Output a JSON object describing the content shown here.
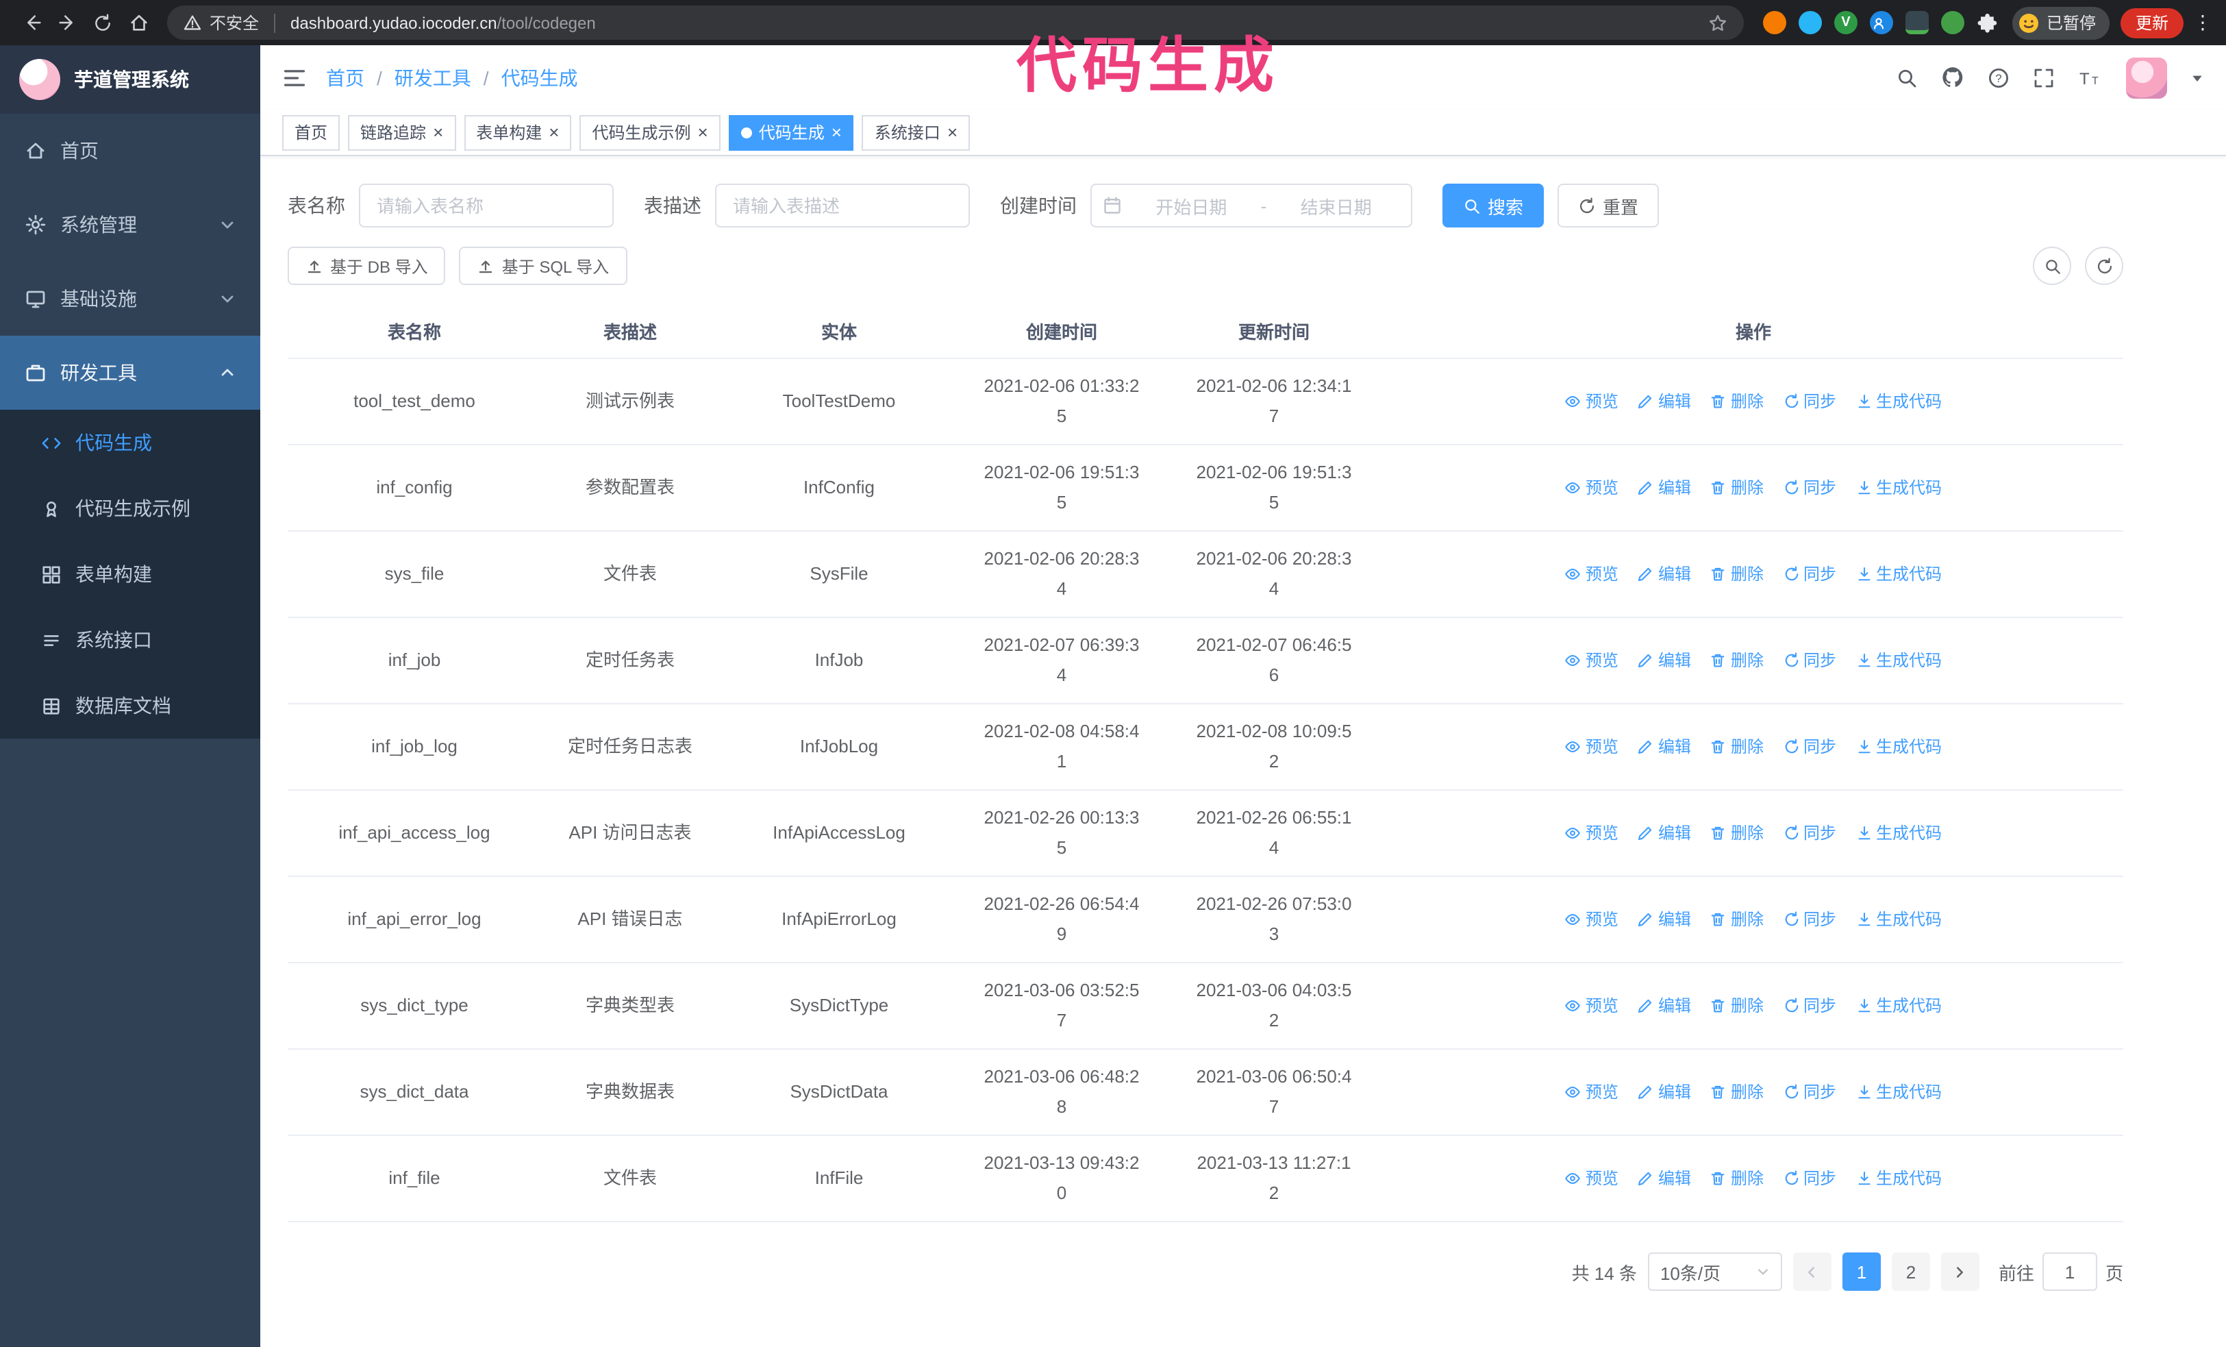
{
  "theme": {
    "accent": "#409eff",
    "sidebar_bg": "#304156",
    "submenu_bg": "#1f2d3d",
    "annotation_color": "#ee3f7d",
    "update_button_bg": "#d93025"
  },
  "annotation": {
    "text": "代码生成"
  },
  "browser": {
    "security_label": "不安全",
    "url_domain": "dashboard.yudao.iocoder.cn",
    "url_path": "/tool/codegen",
    "profile_badge": "已暂停",
    "update_label": "更新",
    "kebab": "⋮",
    "extension_v_label": "V"
  },
  "sidebar": {
    "title": "芋道管理系统",
    "items": [
      {
        "label": "首页"
      },
      {
        "label": "系统管理"
      },
      {
        "label": "基础设施"
      },
      {
        "label": "研发工具"
      }
    ],
    "subitems": [
      {
        "label": "代码生成"
      },
      {
        "label": "代码生成示例"
      },
      {
        "label": "表单构建"
      },
      {
        "label": "系统接口"
      },
      {
        "label": "数据库文档"
      }
    ]
  },
  "breadcrumb": {
    "items": [
      "首页",
      "研发工具",
      "代码生成"
    ],
    "separator": "/"
  },
  "tabs": [
    {
      "label": "首页"
    },
    {
      "label": "链路追踪"
    },
    {
      "label": "表单构建"
    },
    {
      "label": "代码生成示例"
    },
    {
      "label": "代码生成"
    },
    {
      "label": "系统接口"
    }
  ],
  "tab_close": "×",
  "filters": {
    "table_name_label": "表名称",
    "table_name_placeholder": "请输入表名称",
    "table_desc_label": "表描述",
    "table_desc_placeholder": "请输入表描述",
    "create_time_label": "创建时间",
    "date_start": "开始日期",
    "date_sep": "-",
    "date_end": "结束日期",
    "search": "搜索",
    "reset": "重置"
  },
  "toolbar": {
    "import_db": "基于 DB 导入",
    "import_sql": "基于 SQL 导入"
  },
  "table": {
    "columns": [
      "表名称",
      "表描述",
      "实体",
      "创建时间",
      "更新时间",
      "操作"
    ],
    "actions": [
      "预览",
      "编辑",
      "删除",
      "同步",
      "生成代码"
    ],
    "rows": [
      {
        "name": "tool_test_demo",
        "desc": "测试示例表",
        "entity": "ToolTestDemo",
        "created": "2021-02-06 01:33:25",
        "updated": "2021-02-06 12:34:17"
      },
      {
        "name": "inf_config",
        "desc": "参数配置表",
        "entity": "InfConfig",
        "created": "2021-02-06 19:51:35",
        "updated": "2021-02-06 19:51:35"
      },
      {
        "name": "sys_file",
        "desc": "文件表",
        "entity": "SysFile",
        "created": "2021-02-06 20:28:34",
        "updated": "2021-02-06 20:28:34"
      },
      {
        "name": "inf_job",
        "desc": "定时任务表",
        "entity": "InfJob",
        "created": "2021-02-07 06:39:34",
        "updated": "2021-02-07 06:46:56"
      },
      {
        "name": "inf_job_log",
        "desc": "定时任务日志表",
        "entity": "InfJobLog",
        "created": "2021-02-08 04:58:41",
        "updated": "2021-02-08 10:09:52"
      },
      {
        "name": "inf_api_access_log",
        "desc": "API 访问日志表",
        "entity": "InfApiAccessLog",
        "created": "2021-02-26 00:13:35",
        "updated": "2021-02-26 06:55:14"
      },
      {
        "name": "inf_api_error_log",
        "desc": "API 错误日志",
        "entity": "InfApiErrorLog",
        "created": "2021-02-26 06:54:49",
        "updated": "2021-02-26 07:53:03"
      },
      {
        "name": "sys_dict_type",
        "desc": "字典类型表",
        "entity": "SysDictType",
        "created": "2021-03-06 03:52:57",
        "updated": "2021-03-06 04:03:52"
      },
      {
        "name": "sys_dict_data",
        "desc": "字典数据表",
        "entity": "SysDictData",
        "created": "2021-03-06 06:48:28",
        "updated": "2021-03-06 06:50:47"
      },
      {
        "name": "inf_file",
        "desc": "文件表",
        "entity": "InfFile",
        "created": "2021-03-13 09:43:20",
        "updated": "2021-03-13 11:27:12"
      }
    ]
  },
  "pagination": {
    "total": "共 14 条",
    "page_size": "10条/页",
    "pages": [
      "1",
      "2"
    ],
    "goto_label": "前往",
    "goto_value": "1",
    "page_unit": "页"
  }
}
